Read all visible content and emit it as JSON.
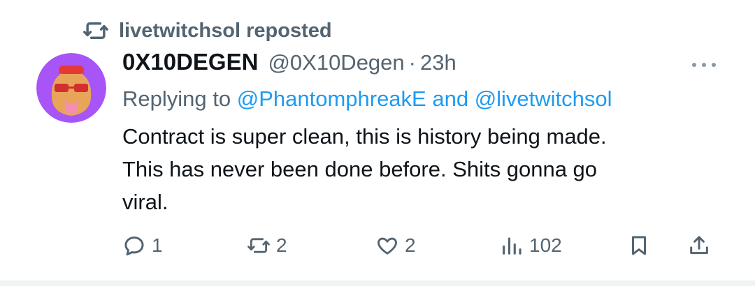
{
  "repost": {
    "icon": "repost-icon",
    "text": "livetwitchsol reposted"
  },
  "tweet": {
    "author": {
      "display_name": "0X10DEGEN",
      "handle": "@0X10Degen",
      "separator": "·",
      "time": "23h"
    },
    "replying": {
      "prefix": "Replying to ",
      "mention1": "@PhantomphreakE",
      "and": " and ",
      "mention2": "@livetwitchsol"
    },
    "text": "Contract is super clean, this is history being made.\nThis has never been done before. Shits gonna go\nviral."
  },
  "actions": {
    "reply": {
      "icon": "reply-icon",
      "count": "1"
    },
    "retweet": {
      "icon": "repost-icon",
      "count": "2"
    },
    "like": {
      "icon": "heart-icon",
      "count": "2"
    },
    "views": {
      "icon": "views-icon",
      "count": "102"
    },
    "bookmark": {
      "icon": "bookmark-icon"
    },
    "share": {
      "icon": "share-icon"
    }
  },
  "colors": {
    "text": "#0f1419",
    "secondary": "#536471",
    "link": "#1d9bf0",
    "avatar_bg": "#a855f7"
  }
}
